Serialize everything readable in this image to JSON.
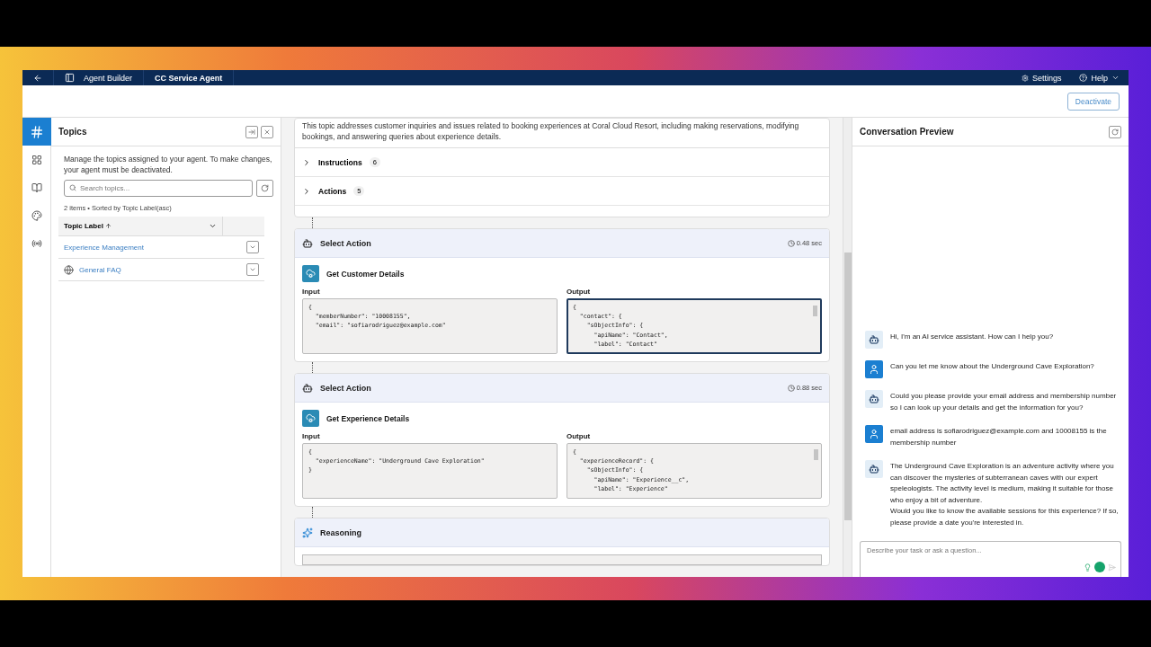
{
  "header": {
    "app_name": "Agent Builder",
    "agent_name": "CC Service Agent",
    "settings": "Settings",
    "help": "Help"
  },
  "toolbar": {
    "deactivate": "Deactivate"
  },
  "rail": [
    {
      "kind": "hash",
      "selected": true
    },
    {
      "kind": "apps",
      "selected": false
    },
    {
      "kind": "book",
      "selected": false
    },
    {
      "kind": "palette",
      "selected": false
    },
    {
      "kind": "signal",
      "selected": false
    }
  ],
  "topics": {
    "title": "Topics",
    "description": "Manage the topics assigned to your agent. To make changes, your agent must be deactivated.",
    "search": {
      "placeholder": "Search topics..."
    },
    "summary": "2 items • Sorted by Topic Label(asc)",
    "column": "Topic Label",
    "rows": [
      {
        "kind": "plain",
        "label": "Experience Management"
      },
      {
        "kind": "globe",
        "label": "General FAQ"
      }
    ]
  },
  "topic_detail": {
    "description": "This topic addresses customer inquiries and issues related to booking experiences at Coral Cloud Resort, including making reservations, modifying bookings, and answering queries about experience details.",
    "sections": [
      {
        "label": "Instructions",
        "count": "6",
        "expanded": false
      },
      {
        "label": "Actions",
        "count": "5",
        "expanded": false
      }
    ]
  },
  "steps": [
    {
      "kind": "action",
      "title": "Select Action",
      "time": "0.48 sec",
      "action": "Get Customer Details",
      "input_label": "Input",
      "output_label": "Output",
      "output_focused": true,
      "input": [
        "{",
        "  \"memberNumber\": \"10008155\",",
        "  \"email\": \"sofiarodriguez@example.com\""
      ],
      "output": [
        "{",
        "  \"contact\": {",
        "    \"sObjectInfo\": {",
        "      \"apiName\": \"Contact\",",
        "      \"label\": \"Contact\""
      ]
    },
    {
      "kind": "action",
      "title": "Select Action",
      "time": "0.88 sec",
      "action": "Get Experience Details",
      "input_label": "Input",
      "output_label": "Output",
      "output_focused": false,
      "input": [
        "{",
        "  \"experienceName\": \"Underground Cave Exploration\"",
        "}"
      ],
      "output": [
        "{",
        "  \"experienceRecord\": {",
        "    \"sObjectInfo\": {",
        "      \"apiName\": \"Experience__c\",",
        "      \"label\": \"Experience\""
      ]
    },
    {
      "kind": "reasoning",
      "title": "Reasoning"
    }
  ],
  "conversation": {
    "title": "Conversation Preview",
    "messages": [
      {
        "kind": "agent",
        "text": "Hi, I'm an AI service assistant. How can I help you?"
      },
      {
        "kind": "user",
        "text": "Can you let me know about the Underground Cave Exploration?"
      },
      {
        "kind": "agent",
        "text": "Could you please provide your email address and membership number so I can look up your details and get the information for you?"
      },
      {
        "kind": "user",
        "text": "email address is sofiarodriguez@example.com and 10008155 is the membership number"
      },
      {
        "kind": "agent",
        "text": "The Underground Cave Exploration is an adventure activity where you can discover the mysteries of subterranean caves with our expert speleologists. The activity level is medium, making it suitable for those who enjoy a bit of adventure.\nWould you like to know the available sessions for this experience? If so, please provide a date you're interested in."
      }
    ],
    "input": {
      "placeholder": "Describe your task or ask a question..."
    }
  }
}
